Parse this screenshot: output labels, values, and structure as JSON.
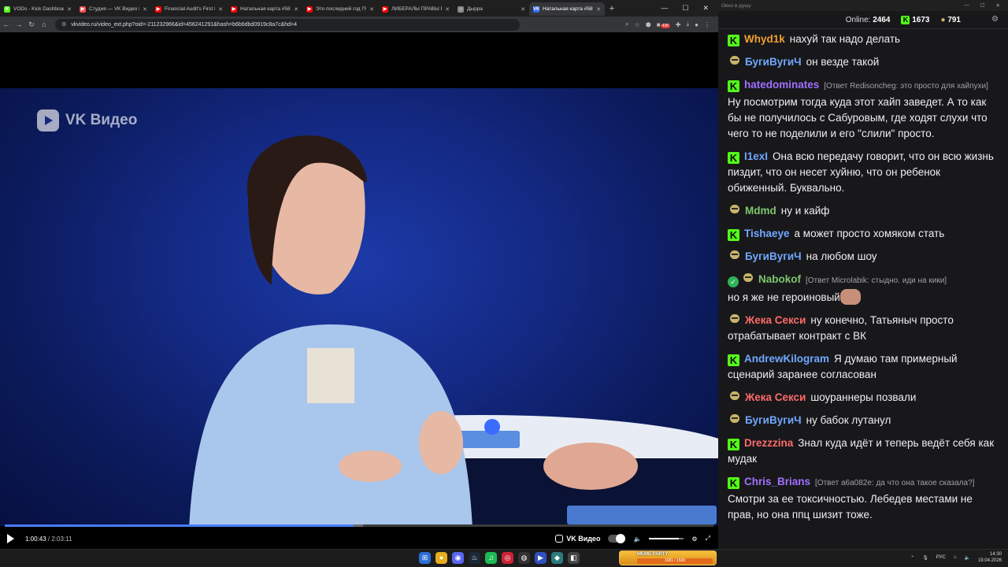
{
  "browser": {
    "tabs": [
      {
        "label": "VODs - Kick Dashboard",
        "color": "#53fc18",
        "icon": "K",
        "active": false
      },
      {
        "label": "Студия — VK Видео Live",
        "color": "#ff4d4d",
        "icon": "▶",
        "active": false
      },
      {
        "label": "Financial Audit's First F",
        "color": "#ff0000",
        "icon": "▶",
        "active": false
      },
      {
        "label": "Натальная карта #58 ...",
        "color": "#ff0000",
        "icon": "▶",
        "active": false
      },
      {
        "label": "Это последний год Пу",
        "color": "#ff0000",
        "icon": "▶",
        "active": false
      },
      {
        "label": "ЛИБЕРАЛЫ ПРАВЫ ВО",
        "color": "#ff0000",
        "icon": "▶",
        "active": false
      },
      {
        "label": "Дырра",
        "color": "#888888",
        "icon": "⌂",
        "active": false
      },
      {
        "label": "Натальная карта #58 ...",
        "color": "#2f6bff",
        "icon": "VK",
        "active": true
      }
    ],
    "url": "vkvideo.ru/video_ext.php?oid=-211232966&id=456241291&hash=b6b6dbd0919c8a7c&hd=4",
    "ext_badge": "438"
  },
  "video": {
    "watermark": "VK Видео",
    "current_time": "1:00:43",
    "separator": " / ",
    "duration": "2:03:11",
    "progress_fraction": 0.4925,
    "buffer_fraction": 0.505,
    "volume_fraction": 0.85,
    "brand_label": "VK Видео",
    "accent": "#4a7cff"
  },
  "chat": {
    "window_title": "Окно в душу",
    "online_label": "Online:",
    "online_count": "2464",
    "kick_count": "1673",
    "other_count": "791",
    "messages": [
      {
        "badge": "kick",
        "user": "Whyd1k",
        "color": "#f0a030",
        "reply": "",
        "text": "нахуй так надо делать"
      },
      {
        "badge": "face",
        "user": "БугиВугиЧ",
        "color": "#6fa8ff",
        "reply": "",
        "text": "он везде такой"
      },
      {
        "badge": "kick",
        "user": "hatedominates",
        "color": "#a070ff",
        "reply": "[Ответ Redisoncheg: это просто для хайпухи]",
        "text": "Ну посмотрим тогда куда этот хайп заведет. А то как бы не получилось с Сабуровым, где ходят слухи что чего то не поделили и его \"слили\" просто."
      },
      {
        "badge": "kick",
        "user": "I1exI",
        "color": "#6fa8ff",
        "reply": "",
        "text": "Она всю передачу говорит, что он всю жизнь пиздит, что он несет хуйню, что он ребенок обиженный. Буквально."
      },
      {
        "badge": "face",
        "user": "Mdmd",
        "color": "#7fc56e",
        "reply": "",
        "text": "ну и кайф"
      },
      {
        "badge": "kick",
        "user": "Tishaeye",
        "color": "#6fa8ff",
        "reply": "",
        "text": "а может просто хомяком стать"
      },
      {
        "badge": "face",
        "user": "БугиВугиЧ",
        "color": "#6fa8ff",
        "reply": "",
        "text": "на любом шоу"
      },
      {
        "badge": "verified-face",
        "user": "Nabokof",
        "color": "#7fc56e",
        "reply": "[Ответ Microlabik: стыдно. иди на кики]",
        "text": "но я же не героиновый",
        "emote": true
      },
      {
        "badge": "face",
        "user": "Жека Секси",
        "color": "#ff6a6a",
        "reply": "",
        "text": "ну конечно, Татьяныч просто отрабатывает контракт с ВК"
      },
      {
        "badge": "kick",
        "user": "AndrewKilogram",
        "color": "#6fa8ff",
        "reply": "",
        "text": "Я думаю там примерный сценарий заранее согласован"
      },
      {
        "badge": "face",
        "user": "Жека Секси",
        "color": "#ff6a6a",
        "reply": "",
        "text": "шоураннеры позвали"
      },
      {
        "badge": "face",
        "user": "БугиВугиЧ",
        "color": "#6fa8ff",
        "reply": "",
        "text": "ну бабок лутанул"
      },
      {
        "badge": "kick",
        "user": "Drezzzina",
        "color": "#ff6a6a",
        "reply": "",
        "text": "Знал куда идёт и теперь ведёт себя как мудак"
      },
      {
        "badge": "kick",
        "user": "Chris_Brians",
        "color": "#a070ff",
        "reply": "[Ответ a6a082e: да что она такое сказала?]",
        "text": "Смотри за ее токсичностью. Лебедев местами не прав, но она ппц шизит тоже."
      }
    ]
  },
  "taskbar": {
    "meme_title": "MEME PARTY",
    "meme_value": "1681 / 1500",
    "meme_fraction": 1.0,
    "lang": "РУС",
    "time": "14:30",
    "date": "19.04.2026"
  }
}
